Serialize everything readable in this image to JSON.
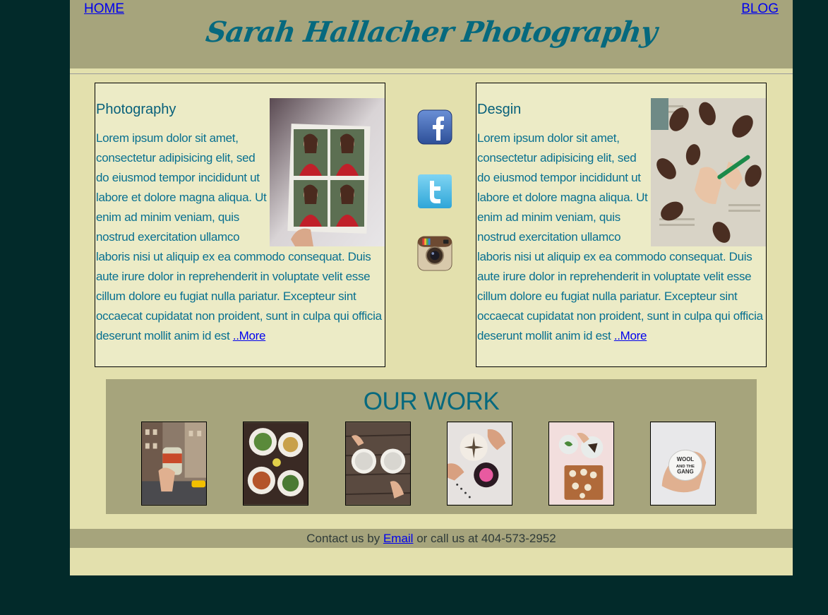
{
  "nav": {
    "home_label": "HOME",
    "blog_label": "BLOG"
  },
  "site_title": "Sarah Hallacher Photography",
  "panels": [
    {
      "title": "Photography",
      "text": "Lorem ipsum dolor sit amet, consectetur adipisicing elit, sed do eiusmod tempor incididunt ut labore et dolore magna aliqua. Ut enim ad minim veniam, quis nostrud exercitation ullamco laboris nisi ut aliquip ex ea commodo consequat. Duis aute irure dolor in reprehenderit in voluptate velit esse cillum dolore eu fugiat nulla pariatur. Excepteur sint occaecat cupidatat non proident, sunt in culpa qui officia deserunt mollit anim id est ",
      "more_label": "..More",
      "image": "photo-strip-image"
    },
    {
      "title": "Desgin",
      "text": "Lorem ipsum dolor sit amet, consectetur adipisicing elit, sed do eiusmod tempor incididunt ut labore et dolore magna aliqua. Ut enim ad minim veniam, quis nostrud exercitation ullamco laboris nisi ut aliquip ex ea commodo consequat. Duis aute irure dolor in reprehenderit in voluptate velit esse cillum dolore eu fugiat nulla pariatur. Excepteur sint occaecat cupidatat non proident, sunt in culpa qui officia deserunt mollit anim id est ",
      "more_label": "..More",
      "image": "pinecones-image"
    }
  ],
  "social_icons": [
    "facebook-icon",
    "twitter-icon",
    "instagram-icon"
  ],
  "work": {
    "title": "OUR WORK",
    "thumbnails": [
      "nuts-can-street",
      "food-table",
      "coffee-cups",
      "cupcakes",
      "cutting-board",
      "wool-and-the-gang"
    ]
  },
  "footer": {
    "prefix": "Contact us by ",
    "email_label": "Email",
    "suffix": " or call us at 404-573-2952"
  },
  "colors": {
    "background": "#022a2a",
    "page": "#e3e0ad",
    "band": "#a6a47c",
    "accent": "#06697e"
  }
}
